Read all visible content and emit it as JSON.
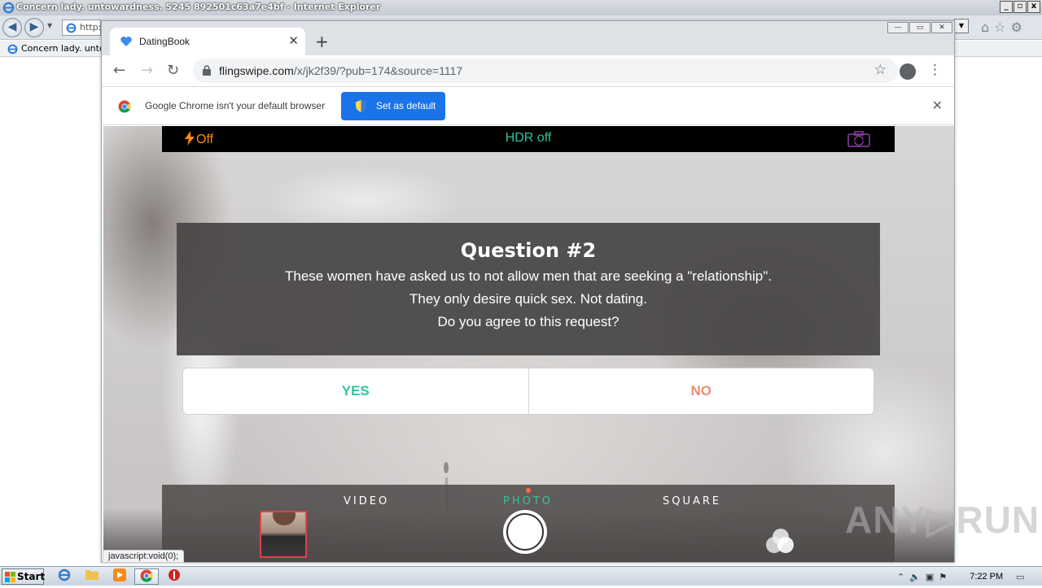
{
  "ie": {
    "title": "Concern lady. untowardness. 5245 892501c63a7e4bf - Internet Explorer",
    "address_text": "http:",
    "tab_label": "Concern lady. untov",
    "win_buttons": [
      "_",
      "▫",
      "x"
    ]
  },
  "chrome": {
    "tab_title": "DatingBook",
    "url_domain": "flingswipe.com",
    "url_path": "/x/jk2f39/?pub=174&source=1117",
    "infobar_message": "Google Chrome isn't your default browser",
    "set_default_label": "Set as default",
    "status_text": "javascript:void(0);"
  },
  "camera": {
    "flash_label": "Off",
    "hdr_label": "HDR off",
    "modes": [
      "VIDEO",
      "PHOTO",
      "SQUARE"
    ],
    "active_mode": "PHOTO"
  },
  "question": {
    "title": "Question #2",
    "lines": [
      "These women have asked us to not allow men that are seeking a \"relationship\".",
      "They only desire quick sex. Not dating.",
      "Do you agree to this request?"
    ],
    "yes_label": "YES",
    "no_label": "NO"
  },
  "watermark": "ANY▷RUN",
  "taskbar": {
    "start_label": "Start",
    "clock": "7:22 PM"
  },
  "colors": {
    "accent_green": "#2ec4a0",
    "no_color": "#f28b72",
    "flash_orange": "#ff8a00",
    "chrome_blue": "#1a73e8"
  }
}
